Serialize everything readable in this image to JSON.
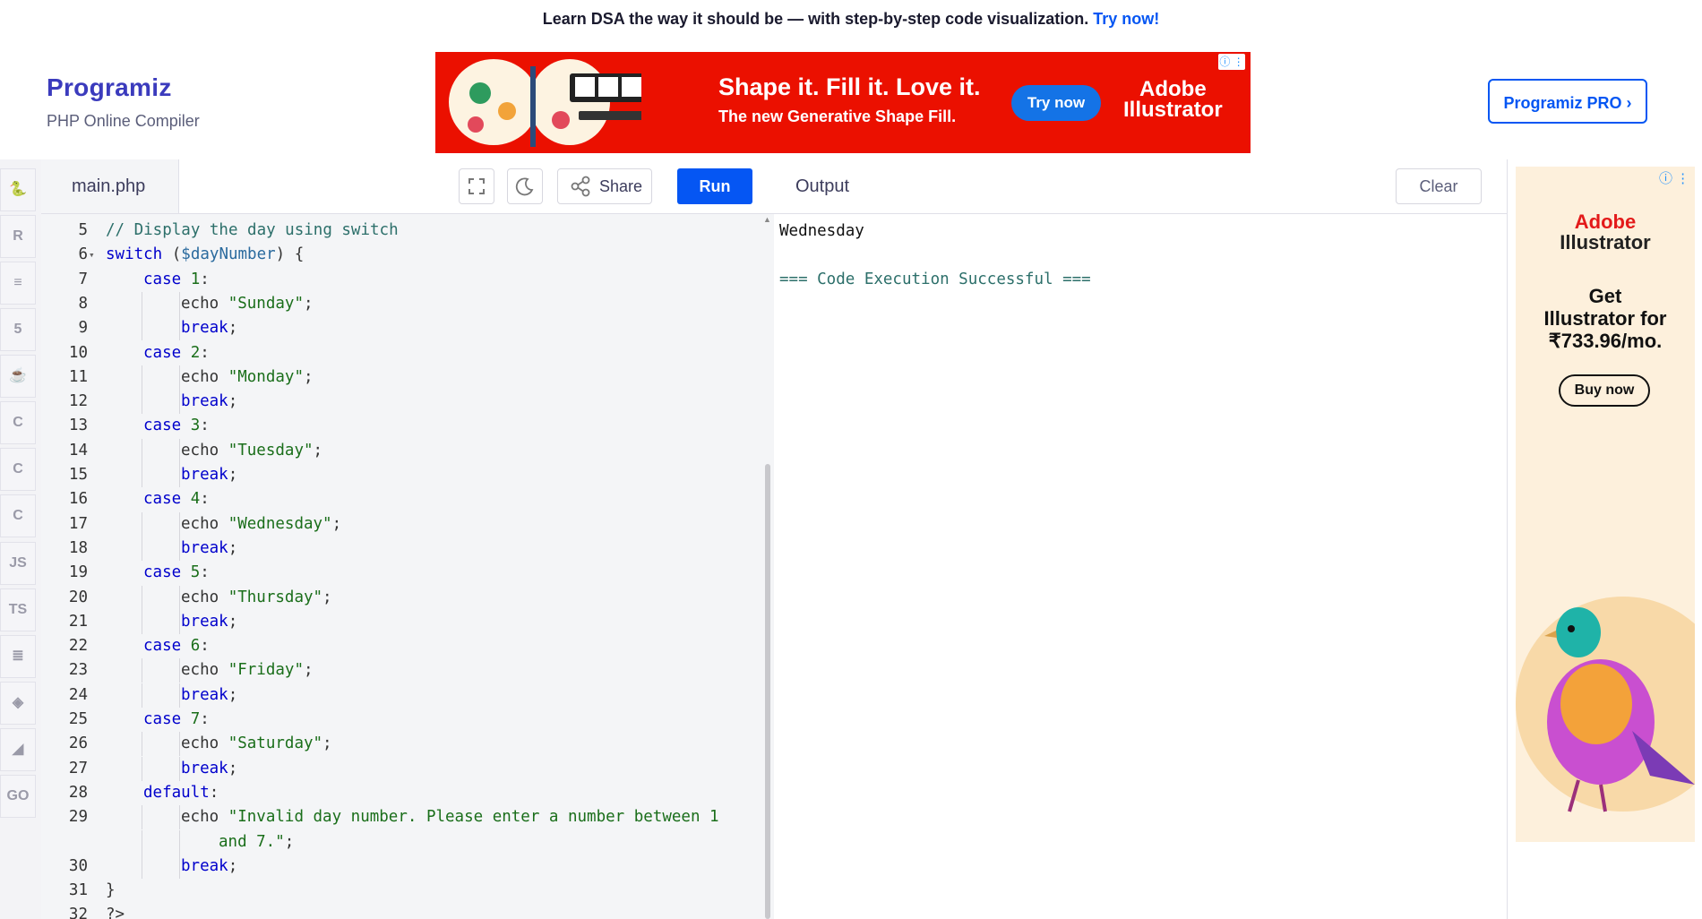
{
  "top_banner": {
    "text": "Learn DSA the way it should be — with step-by-step code visualization.",
    "link": "Try now!"
  },
  "header": {
    "logo": "Programiz",
    "subtitle": "PHP Online Compiler",
    "pro_button": "Programiz PRO ›"
  },
  "ad_banner": {
    "headline": "Shape it. Fill it. Love it.",
    "subline": "The new Generative Shape Fill.",
    "cta": "Try now",
    "brand_line1": "Adobe",
    "brand_line2": "Illustrator",
    "info": "ⓘ ⋮"
  },
  "rail": {
    "items": [
      {
        "name": "python-icon",
        "glyph": "🐍"
      },
      {
        "name": "r-icon",
        "glyph": "R"
      },
      {
        "name": "sql-icon",
        "glyph": "≡"
      },
      {
        "name": "html-icon",
        "glyph": "5"
      },
      {
        "name": "java-icon",
        "glyph": "☕"
      },
      {
        "name": "c-icon",
        "glyph": "C"
      },
      {
        "name": "csharp-icon",
        "glyph": "C"
      },
      {
        "name": "cpp-icon",
        "glyph": "C"
      },
      {
        "name": "js-icon",
        "glyph": "JS"
      },
      {
        "name": "ts-icon",
        "glyph": "TS"
      },
      {
        "name": "rust-icon",
        "glyph": "≣"
      },
      {
        "name": "swift-icon",
        "glyph": "◈"
      },
      {
        "name": "kotlin-icon",
        "glyph": "◢"
      },
      {
        "name": "go-icon",
        "glyph": "GO"
      }
    ]
  },
  "editor": {
    "file_tab": "main.php",
    "share_label": "Share",
    "run_label": "Run",
    "lines": [
      {
        "n": "5",
        "fold": "",
        "indent": 0,
        "tokens": [
          {
            "t": "// Display the day using switch",
            "c": "cm"
          }
        ]
      },
      {
        "n": "6",
        "fold": "▾",
        "indent": 0,
        "tokens": [
          {
            "t": "switch",
            "c": "kw"
          },
          {
            "t": " (",
            "c": ""
          },
          {
            "t": "$dayNumber",
            "c": "var"
          },
          {
            "t": ") {",
            "c": ""
          }
        ]
      },
      {
        "n": "7",
        "fold": "",
        "indent": 1,
        "tokens": [
          {
            "t": "case",
            "c": "kw"
          },
          {
            "t": " ",
            "c": ""
          },
          {
            "t": "1",
            "c": "num"
          },
          {
            "t": ":",
            "c": ""
          }
        ]
      },
      {
        "n": "8",
        "fold": "",
        "indent": 2,
        "tokens": [
          {
            "t": "echo ",
            "c": ""
          },
          {
            "t": "\"Sunday\"",
            "c": "str"
          },
          {
            "t": ";",
            "c": ""
          }
        ]
      },
      {
        "n": "9",
        "fold": "",
        "indent": 2,
        "tokens": [
          {
            "t": "break",
            "c": "kw"
          },
          {
            "t": ";",
            "c": ""
          }
        ]
      },
      {
        "n": "10",
        "fold": "",
        "indent": 1,
        "tokens": [
          {
            "t": "case",
            "c": "kw"
          },
          {
            "t": " ",
            "c": ""
          },
          {
            "t": "2",
            "c": "num"
          },
          {
            "t": ":",
            "c": ""
          }
        ]
      },
      {
        "n": "11",
        "fold": "",
        "indent": 2,
        "tokens": [
          {
            "t": "echo ",
            "c": ""
          },
          {
            "t": "\"Monday\"",
            "c": "str"
          },
          {
            "t": ";",
            "c": ""
          }
        ]
      },
      {
        "n": "12",
        "fold": "",
        "indent": 2,
        "tokens": [
          {
            "t": "break",
            "c": "kw"
          },
          {
            "t": ";",
            "c": ""
          }
        ]
      },
      {
        "n": "13",
        "fold": "",
        "indent": 1,
        "tokens": [
          {
            "t": "case",
            "c": "kw"
          },
          {
            "t": " ",
            "c": ""
          },
          {
            "t": "3",
            "c": "num"
          },
          {
            "t": ":",
            "c": ""
          }
        ]
      },
      {
        "n": "14",
        "fold": "",
        "indent": 2,
        "tokens": [
          {
            "t": "echo ",
            "c": ""
          },
          {
            "t": "\"Tuesday\"",
            "c": "str"
          },
          {
            "t": ";",
            "c": ""
          }
        ]
      },
      {
        "n": "15",
        "fold": "",
        "indent": 2,
        "tokens": [
          {
            "t": "break",
            "c": "kw"
          },
          {
            "t": ";",
            "c": ""
          }
        ]
      },
      {
        "n": "16",
        "fold": "",
        "indent": 1,
        "tokens": [
          {
            "t": "case",
            "c": "kw"
          },
          {
            "t": " ",
            "c": ""
          },
          {
            "t": "4",
            "c": "num"
          },
          {
            "t": ":",
            "c": ""
          }
        ]
      },
      {
        "n": "17",
        "fold": "",
        "indent": 2,
        "tokens": [
          {
            "t": "echo ",
            "c": ""
          },
          {
            "t": "\"Wednesday\"",
            "c": "str"
          },
          {
            "t": ";",
            "c": ""
          }
        ]
      },
      {
        "n": "18",
        "fold": "",
        "indent": 2,
        "tokens": [
          {
            "t": "break",
            "c": "kw"
          },
          {
            "t": ";",
            "c": ""
          }
        ]
      },
      {
        "n": "19",
        "fold": "",
        "indent": 1,
        "tokens": [
          {
            "t": "case",
            "c": "kw"
          },
          {
            "t": " ",
            "c": ""
          },
          {
            "t": "5",
            "c": "num"
          },
          {
            "t": ":",
            "c": ""
          }
        ]
      },
      {
        "n": "20",
        "fold": "",
        "indent": 2,
        "tokens": [
          {
            "t": "echo ",
            "c": ""
          },
          {
            "t": "\"Thursday\"",
            "c": "str"
          },
          {
            "t": ";",
            "c": ""
          }
        ]
      },
      {
        "n": "21",
        "fold": "",
        "indent": 2,
        "tokens": [
          {
            "t": "break",
            "c": "kw"
          },
          {
            "t": ";",
            "c": ""
          }
        ]
      },
      {
        "n": "22",
        "fold": "",
        "indent": 1,
        "tokens": [
          {
            "t": "case",
            "c": "kw"
          },
          {
            "t": " ",
            "c": ""
          },
          {
            "t": "6",
            "c": "num"
          },
          {
            "t": ":",
            "c": ""
          }
        ]
      },
      {
        "n": "23",
        "fold": "",
        "indent": 2,
        "tokens": [
          {
            "t": "echo ",
            "c": ""
          },
          {
            "t": "\"Friday\"",
            "c": "str"
          },
          {
            "t": ";",
            "c": ""
          }
        ]
      },
      {
        "n": "24",
        "fold": "",
        "indent": 2,
        "tokens": [
          {
            "t": "break",
            "c": "kw"
          },
          {
            "t": ";",
            "c": ""
          }
        ]
      },
      {
        "n": "25",
        "fold": "",
        "indent": 1,
        "tokens": [
          {
            "t": "case",
            "c": "kw"
          },
          {
            "t": " ",
            "c": ""
          },
          {
            "t": "7",
            "c": "num"
          },
          {
            "t": ":",
            "c": ""
          }
        ]
      },
      {
        "n": "26",
        "fold": "",
        "indent": 2,
        "tokens": [
          {
            "t": "echo ",
            "c": ""
          },
          {
            "t": "\"Saturday\"",
            "c": "str"
          },
          {
            "t": ";",
            "c": ""
          }
        ]
      },
      {
        "n": "27",
        "fold": "",
        "indent": 2,
        "tokens": [
          {
            "t": "break",
            "c": "kw"
          },
          {
            "t": ";",
            "c": ""
          }
        ]
      },
      {
        "n": "28",
        "fold": "",
        "indent": 1,
        "tokens": [
          {
            "t": "default",
            "c": "kw"
          },
          {
            "t": ":",
            "c": ""
          }
        ]
      },
      {
        "n": "29",
        "fold": "",
        "indent": 2,
        "tokens": [
          {
            "t": "echo ",
            "c": ""
          },
          {
            "t": "\"Invalid day number. Please enter a number between 1",
            "c": "str"
          }
        ]
      },
      {
        "n": "",
        "fold": "",
        "indent": 3,
        "tokens": [
          {
            "t": "and 7.\"",
            "c": "str"
          },
          {
            "t": ";",
            "c": ""
          }
        ]
      },
      {
        "n": "30",
        "fold": "",
        "indent": 2,
        "tokens": [
          {
            "t": "break",
            "c": "kw"
          },
          {
            "t": ";",
            "c": ""
          }
        ]
      },
      {
        "n": "31",
        "fold": "",
        "indent": 0,
        "tokens": [
          {
            "t": "}",
            "c": ""
          }
        ]
      },
      {
        "n": "32",
        "fold": "",
        "indent": 0,
        "tokens": [
          {
            "t": "?>",
            "c": ""
          }
        ]
      }
    ]
  },
  "output": {
    "title": "Output",
    "clear_label": "Clear",
    "lines": [
      "Wednesday",
      "",
      "=== Code Execution Successful ==="
    ]
  },
  "side_ad": {
    "brand_line1": "Adobe",
    "brand_line2": "Illustrator",
    "offer_line1": "Get",
    "offer_line2": "Illustrator for",
    "offer_line3": "₹733.96/mo.",
    "cta": "Buy now",
    "info": "ⓘ ⋮"
  },
  "colors": {
    "brand_blue": "#0556f3",
    "ad_red": "#eb1000",
    "keyword": "#0000cc",
    "string": "#1a6e1a",
    "comment": "#2c6f6a"
  }
}
